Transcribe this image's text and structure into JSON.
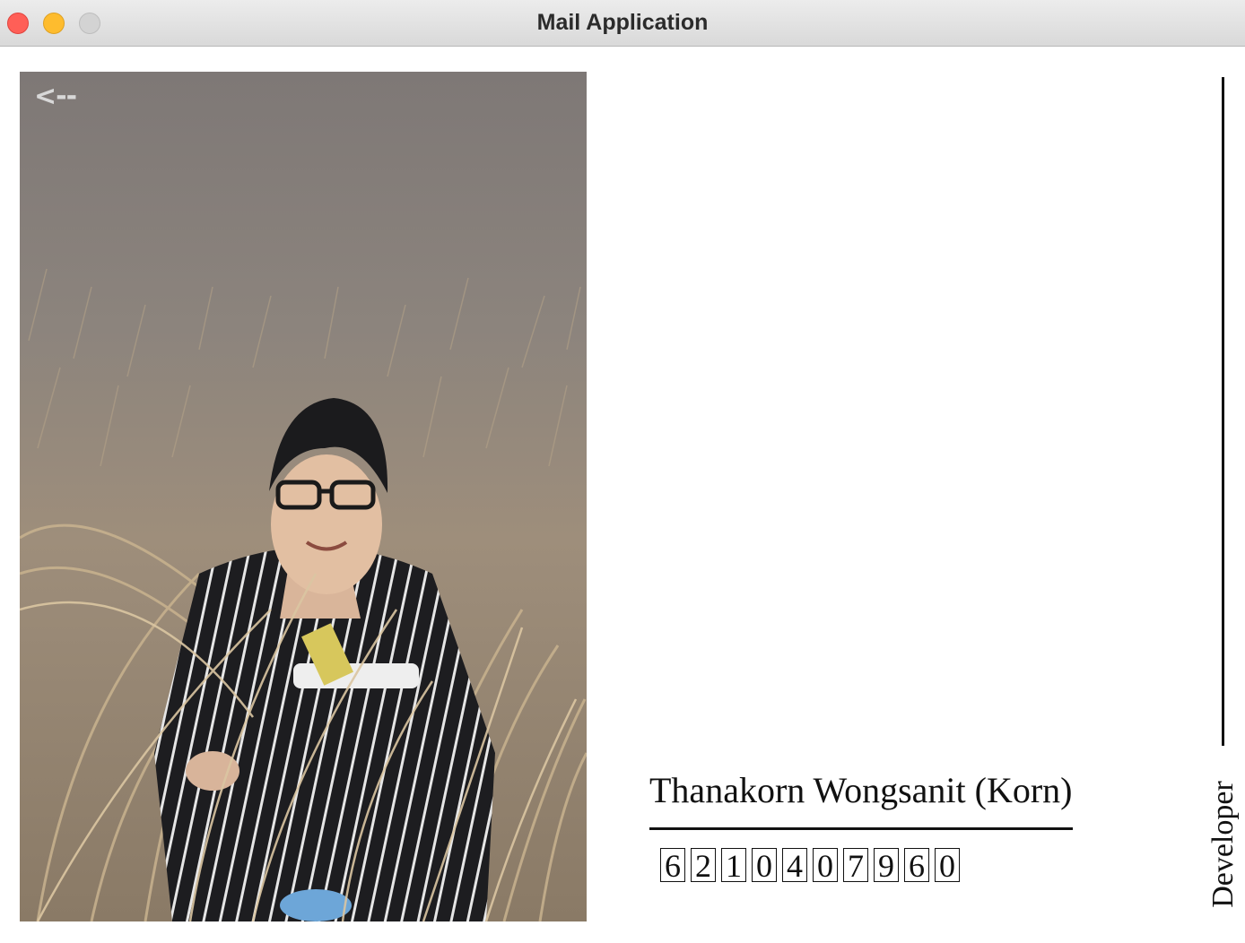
{
  "window": {
    "title": "Mail Application"
  },
  "photo": {
    "back_label": "<--"
  },
  "developer": {
    "name": "Thanakorn Wongsanit (Korn)",
    "student_id_digits": [
      "6",
      "2",
      "1",
      "0",
      "4",
      "0",
      "7",
      "9",
      "6",
      "0"
    ],
    "role_label": "Developer"
  },
  "colors": {
    "text": "#111111",
    "background": "#ffffff",
    "close": "#ff5f57",
    "minimize": "#febc2e",
    "maximize": "#d3d3d3"
  }
}
